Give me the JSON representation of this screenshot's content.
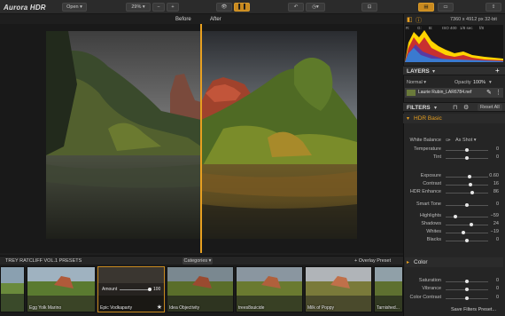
{
  "app": {
    "logo": "Aurora HDR"
  },
  "toolbar": {
    "open_label": "Open",
    "zoom_value": "29%",
    "zoom_minus": "−",
    "zoom_plus": "+",
    "undo_icon": "undo-icon",
    "history_icon": "history-clock-icon",
    "crop_icon": "crop-icon",
    "eye_icon": "eye-icon",
    "compare_icon": "split-compare-icon"
  },
  "compare": {
    "before": "Before",
    "after": "After"
  },
  "panel": {
    "image_info": "7360 x 4912 px  32-bit",
    "histogram_info": [
      "R:",
      "G:",
      "B:",
      "ISO 400",
      "1/8 sec",
      "f/8"
    ],
    "layers_title": "LAYERS",
    "layer_blend": "Normal",
    "opacity_label": "Opacity",
    "opacity_value": "100%",
    "layer_name": "Laurie Rubin_LAR6784.nef",
    "filters_title": "FILTERS",
    "reset_all": "Reset All",
    "hdr_basic": {
      "title": "HDR Basic",
      "white_balance_label": "White Balance",
      "white_balance_value": "As Shot",
      "rows": [
        {
          "label": "Temperature",
          "value": "0",
          "pos": 0.5
        },
        {
          "label": "Tint",
          "value": "0",
          "pos": 0.5
        },
        {
          "label": "Exposure",
          "value": "0.60",
          "pos": 0.56
        },
        {
          "label": "Contrast",
          "value": "16",
          "pos": 0.58
        },
        {
          "label": "HDR Enhance",
          "value": "86",
          "pos": 0.62
        },
        {
          "label": "Smart Tone",
          "value": "0",
          "pos": 0.5
        },
        {
          "label": "Highlights",
          "value": "−59",
          "pos": 0.22
        },
        {
          "label": "Shadows",
          "value": "24",
          "pos": 0.6
        },
        {
          "label": "Whites",
          "value": "−19",
          "pos": 0.42
        },
        {
          "label": "Blacks",
          "value": "0",
          "pos": 0.5
        }
      ]
    },
    "color": {
      "title": "Color",
      "rows": [
        {
          "label": "Saturation",
          "value": "0",
          "pos": 0.5
        },
        {
          "label": "Vibrance",
          "value": "0",
          "pos": 0.5
        },
        {
          "label": "Color Contrast",
          "value": "0",
          "pos": 0.5
        }
      ]
    },
    "save_filters": "Save Filters Preset..."
  },
  "presets": {
    "collection": "TREY RATCLIFF VOL.1 PRESETS",
    "categories": "Categories",
    "overlay": "+ Overlay Preset",
    "amount_label": "Amount",
    "amount_value": "100",
    "items": [
      {
        "name": ""
      },
      {
        "name": "Egg Yolk Marino"
      },
      {
        "name": "Epic Vodkaparty"
      },
      {
        "name": "Idea Objectivity"
      },
      {
        "name": "trees8suicide"
      },
      {
        "name": "Milk of Poppy"
      },
      {
        "name": "Tarnished..."
      }
    ]
  },
  "colors": {
    "accent": "#e8a020",
    "panel": "#252525",
    "background": "#1e1e1e"
  }
}
